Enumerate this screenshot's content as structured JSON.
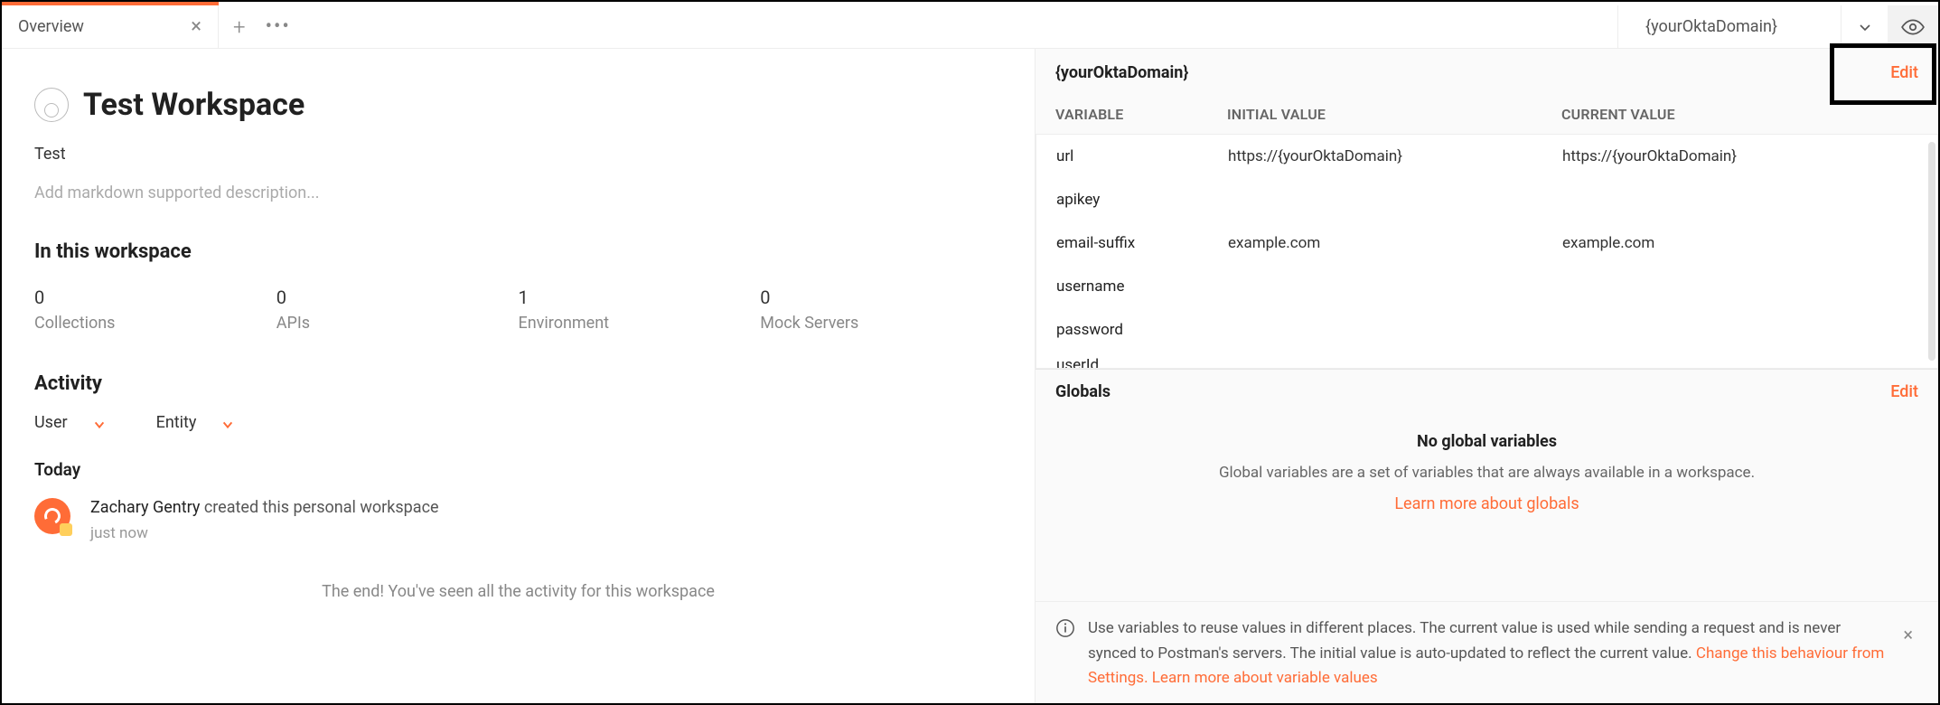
{
  "tab": {
    "label": "Overview"
  },
  "env": {
    "selectorLabel": "{yourOktaDomain}"
  },
  "workspace": {
    "title": "Test Workspace",
    "subtitle": "Test",
    "descriptionPlaceholder": "Add markdown supported description...",
    "sectionTitle": "In this workspace"
  },
  "stats": [
    {
      "count": "0",
      "label": "Collections"
    },
    {
      "count": "0",
      "label": "APIs"
    },
    {
      "count": "1",
      "label": "Environment"
    },
    {
      "count": "0",
      "label": "Mock Servers"
    }
  ],
  "activity": {
    "title": "Activity",
    "filters": {
      "user": "User",
      "entity": "Entity"
    },
    "todayLabel": "Today",
    "item": {
      "name": "Zachary Gentry",
      "action": " created this personal workspace",
      "time": "just now"
    },
    "endText": "The end! You've seen all the activity for this workspace"
  },
  "envPanel": {
    "name": "{yourOktaDomain}",
    "editLabel": "Edit",
    "columns": {
      "variable": "VARIABLE",
      "initial": "INITIAL VALUE",
      "current": "CURRENT VALUE"
    },
    "rows": [
      {
        "variable": "url",
        "initial": "https://{yourOktaDomain}",
        "current": "https://{yourOktaDomain}"
      },
      {
        "variable": "apikey",
        "initial": "",
        "current": ""
      },
      {
        "variable": "email-suffix",
        "initial": "example.com",
        "current": "example.com"
      },
      {
        "variable": "username",
        "initial": "",
        "current": ""
      },
      {
        "variable": "password",
        "initial": "",
        "current": ""
      },
      {
        "variable": "userId",
        "initial": "",
        "current": ""
      }
    ]
  },
  "globals": {
    "title": "Globals",
    "editLabel": "Edit",
    "emptyTitle": "No global variables",
    "emptySub": "Global variables are a set of variables that are always available in a workspace.",
    "learnMore": "Learn more about globals"
  },
  "tip": {
    "text1": "Use variables to reuse values in different places. The current value is used while sending a request and is never synced to Postman's servers. The initial value is auto-updated to reflect the current value. ",
    "changeLink": "Change this behaviour from Settings.",
    "learnLink": " Learn more about variable values"
  }
}
